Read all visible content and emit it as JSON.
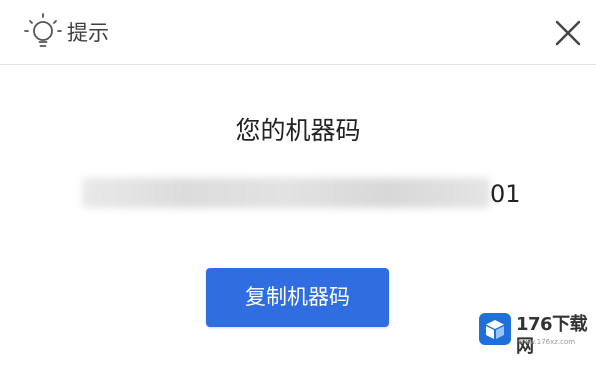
{
  "dialog": {
    "title": "提示",
    "close_icon": "close-icon",
    "hint_icon": "lightbulb-icon"
  },
  "content": {
    "heading": "您的机器码",
    "code_visible_suffix": "01",
    "copy_button_label": "复制机器码"
  },
  "watermark": {
    "text": "176下载网",
    "url": "www.176xz.com",
    "logo_icon": "cube-logo-icon"
  },
  "colors": {
    "accent": "#2f6de1",
    "text_dark": "#222222",
    "header_text": "#404040",
    "divider": "#e4e4e4",
    "watermark_blue": "#1e6fd8"
  }
}
